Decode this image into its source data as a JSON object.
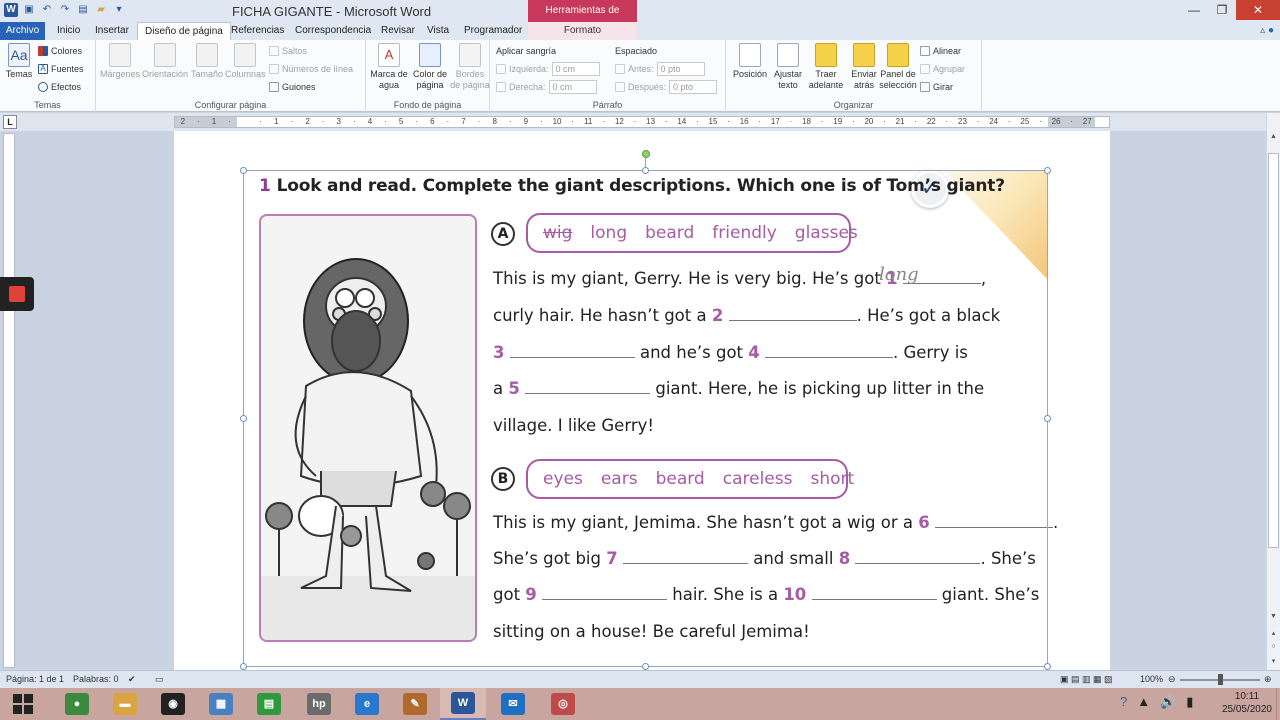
{
  "window": {
    "title": "FICHA GIGANTE - Microsoft Word",
    "context_header": "Herramientas de imagen",
    "minimize": "—",
    "maximize": "❐",
    "close": "✕"
  },
  "tabs": [
    {
      "label": "Archivo"
    },
    {
      "label": "Inicio"
    },
    {
      "label": "Insertar"
    },
    {
      "label": "Diseño de página"
    },
    {
      "label": "Referencias"
    },
    {
      "label": "Correspondencia"
    },
    {
      "label": "Revisar"
    },
    {
      "label": "Vista"
    },
    {
      "label": "Programador"
    },
    {
      "label": "Formato"
    }
  ],
  "ribbon": {
    "temas": {
      "label": "Temas",
      "temas_btn": "Temas",
      "colores": "Colores",
      "fuentes": "Fuentes",
      "efectos": "Efectos"
    },
    "configurar": {
      "label": "Configurar página",
      "margenes": "Márgenes",
      "orientacion": "Orientación",
      "tamano": "Tamaño",
      "columnas": "Columnas",
      "saltos": "Saltos",
      "numeros_linea": "Números de línea",
      "guiones": "Guiones"
    },
    "fondo": {
      "label": "Fondo de página",
      "marca_agua": "Marca de agua",
      "color_pagina": "Color de página",
      "bordes_pagina": "Bordes de página"
    },
    "parrafo": {
      "label": "Párrafo",
      "aplicar_sangria": "Aplicar sangría",
      "izquierda": "Izquierda:",
      "derecha": "Derecha:",
      "izquierda_val": "0 cm",
      "derecha_val": "0 cm",
      "espaciado": "Espaciado",
      "antes": "Antes:",
      "despues": "Después:",
      "antes_val": "0 pto",
      "despues_val": "0 pto"
    },
    "organizar": {
      "label": "Organizar",
      "posicion": "Posición",
      "ajustar_texto": "Ajustar texto",
      "traer_adelante": "Traer adelante",
      "enviar_atras": "Enviar atrás",
      "panel_seleccion": "Panel de selección",
      "alinear": "Alinear",
      "agrupar": "Agrupar",
      "girar": "Girar"
    }
  },
  "ruler": {
    "labels": [
      "2",
      "·",
      "1",
      "·",
      "",
      "·",
      "1",
      "·",
      "2",
      "·",
      "3",
      "·",
      "4",
      "·",
      "5",
      "·",
      "6",
      "·",
      "7",
      "·",
      "8",
      "·",
      "9",
      "·",
      "10",
      "·",
      "11",
      "·",
      "12",
      "·",
      "13",
      "·",
      "14",
      "·",
      "15",
      "·",
      "16",
      "·",
      "17",
      "·",
      "18",
      "·",
      "19",
      "·",
      "20",
      "·",
      "21",
      "·",
      "22",
      "·",
      "23",
      "·",
      "24",
      "·",
      "25",
      "·",
      "26",
      "·",
      "27"
    ],
    "corner": "L"
  },
  "worksheet": {
    "question_number": "1",
    "question_text": "Look and read. Complete the giant descriptions. Which one is of Tom’s giant?",
    "section_a": {
      "letter": "A",
      "words": [
        "wig",
        "long",
        "beard",
        "friendly",
        "glasses"
      ],
      "struck_word_index": 0,
      "handwritten_answer": "long",
      "line1_a": "This is my giant, Gerry. He is very big. He’s got",
      "n1": "1",
      "line1_b": ",",
      "line2_a": "curly hair. He hasn’t got a",
      "n2": "2",
      "line2_b": ". He’s got a black",
      "n3": "3",
      "line3_a": "and he’s got",
      "n4": "4",
      "line3_b": ". Gerry is",
      "line4_a": "a",
      "n5": "5",
      "line4_b": "giant. Here, he is picking up litter in the",
      "line5": "village. I like Gerry!"
    },
    "section_b": {
      "letter": "B",
      "words": [
        "eyes",
        "ears",
        "beard",
        "careless",
        "short"
      ],
      "line1_a": "This is my giant, Jemima. She hasn’t got a wig or a",
      "n6": "6",
      "line1_b": ".",
      "line2_a": "She’s got big",
      "n7": "7",
      "line2_b": "and small",
      "n8": "8",
      "line2_c": ".  She’s",
      "line3_a": "got",
      "n9": "9",
      "line3_b": "hair. She is a",
      "n10": "10",
      "line3_c": "giant. She’s",
      "line4": "sitting on a house! Be careful Jemima!"
    }
  },
  "status": {
    "page": "Página: 1 de 1",
    "words": "Palabras: 0",
    "zoom": "100%"
  },
  "taskbar": {
    "time": "10:11",
    "date": "25/05/2020",
    "apps": [
      {
        "name": "chrome",
        "color": "#3c8a3f",
        "glyph": "●"
      },
      {
        "name": "explorer",
        "color": "#d9a441",
        "glyph": "▬"
      },
      {
        "name": "camera",
        "color": "#222222",
        "glyph": "◉"
      },
      {
        "name": "control-panel",
        "color": "#4a7fc1",
        "glyph": "▦"
      },
      {
        "name": "store",
        "color": "#2f9a3b",
        "glyph": "▤"
      },
      {
        "name": "hp",
        "color": "#6b6b6b",
        "glyph": "hp"
      },
      {
        "name": "internet-explorer",
        "color": "#2a77d0",
        "glyph": "e"
      },
      {
        "name": "paint",
        "color": "#b06a2d",
        "glyph": "✎"
      },
      {
        "name": "word",
        "color": "#2b579a",
        "glyph": "W"
      },
      {
        "name": "mail",
        "color": "#1f6fc5",
        "glyph": "✉"
      },
      {
        "name": "app",
        "color": "#c04a4a",
        "glyph": "◎"
      }
    ]
  },
  "colors": {
    "accent_purple": "#a75ba6",
    "word_blue": "#2b579a",
    "context_tab": "#c7385a"
  }
}
